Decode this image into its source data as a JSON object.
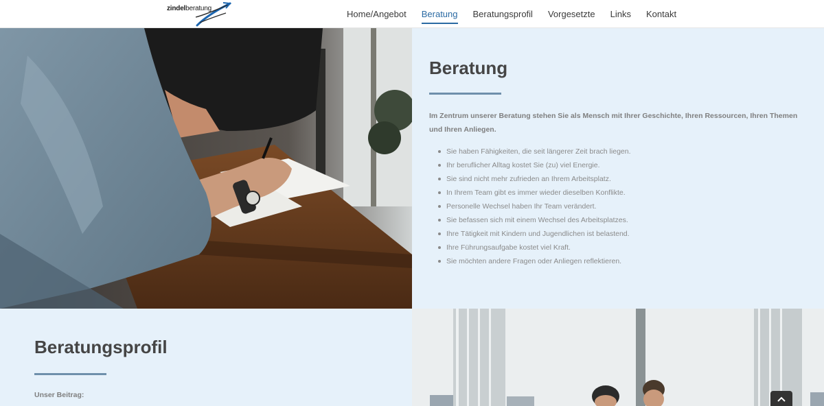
{
  "logo": {
    "part1": "zindel",
    "part2": "beratung"
  },
  "nav": {
    "items": [
      {
        "label": "Home/Angebot"
      },
      {
        "label": "Beratung"
      },
      {
        "label": "Beratungsprofil"
      },
      {
        "label": "Vorgesetzte"
      },
      {
        "label": "Links"
      },
      {
        "label": "Kontakt"
      }
    ],
    "active_index": 1,
    "active_color": "#2a6aa3"
  },
  "beratung": {
    "title": "Beratung",
    "intro": "Im Zentrum unserer Beratung stehen Sie als Mensch mit Ihrer Geschichte, Ihren Ressourcen, Ihren Themen und Ihren Anliegen.",
    "bullets": [
      "Sie haben Fähigkeiten, die seit längerer Zeit brach liegen.",
      "Ihr beruflicher Alltag kostet Sie (zu) viel Energie.",
      "Sie sind nicht mehr zufrieden an Ihrem Arbeitsplatz.",
      "In Ihrem Team gibt es immer wieder dieselben Konflikte.",
      "Personelle Wechsel haben Ihr Team verändert.",
      "Sie befassen sich mit einem Wechsel des Arbeitsplatzes.",
      "Ihre Tätigkeit mit Kindern und Jugendlichen ist belastend.",
      "Ihre Führungsaufgabe kostet viel Kraft.",
      "Sie möchten andere Fragen oder Anliegen reflektieren."
    ]
  },
  "beratungsprofil": {
    "title": "Beratungsprofil",
    "subtitle": "Unser Beitrag:"
  },
  "colors": {
    "panel_bg": "#e6f1fa",
    "rule": "#6e8fab",
    "heading": "#454545"
  },
  "icons": {
    "scroll_top": "chevron-up-icon"
  }
}
